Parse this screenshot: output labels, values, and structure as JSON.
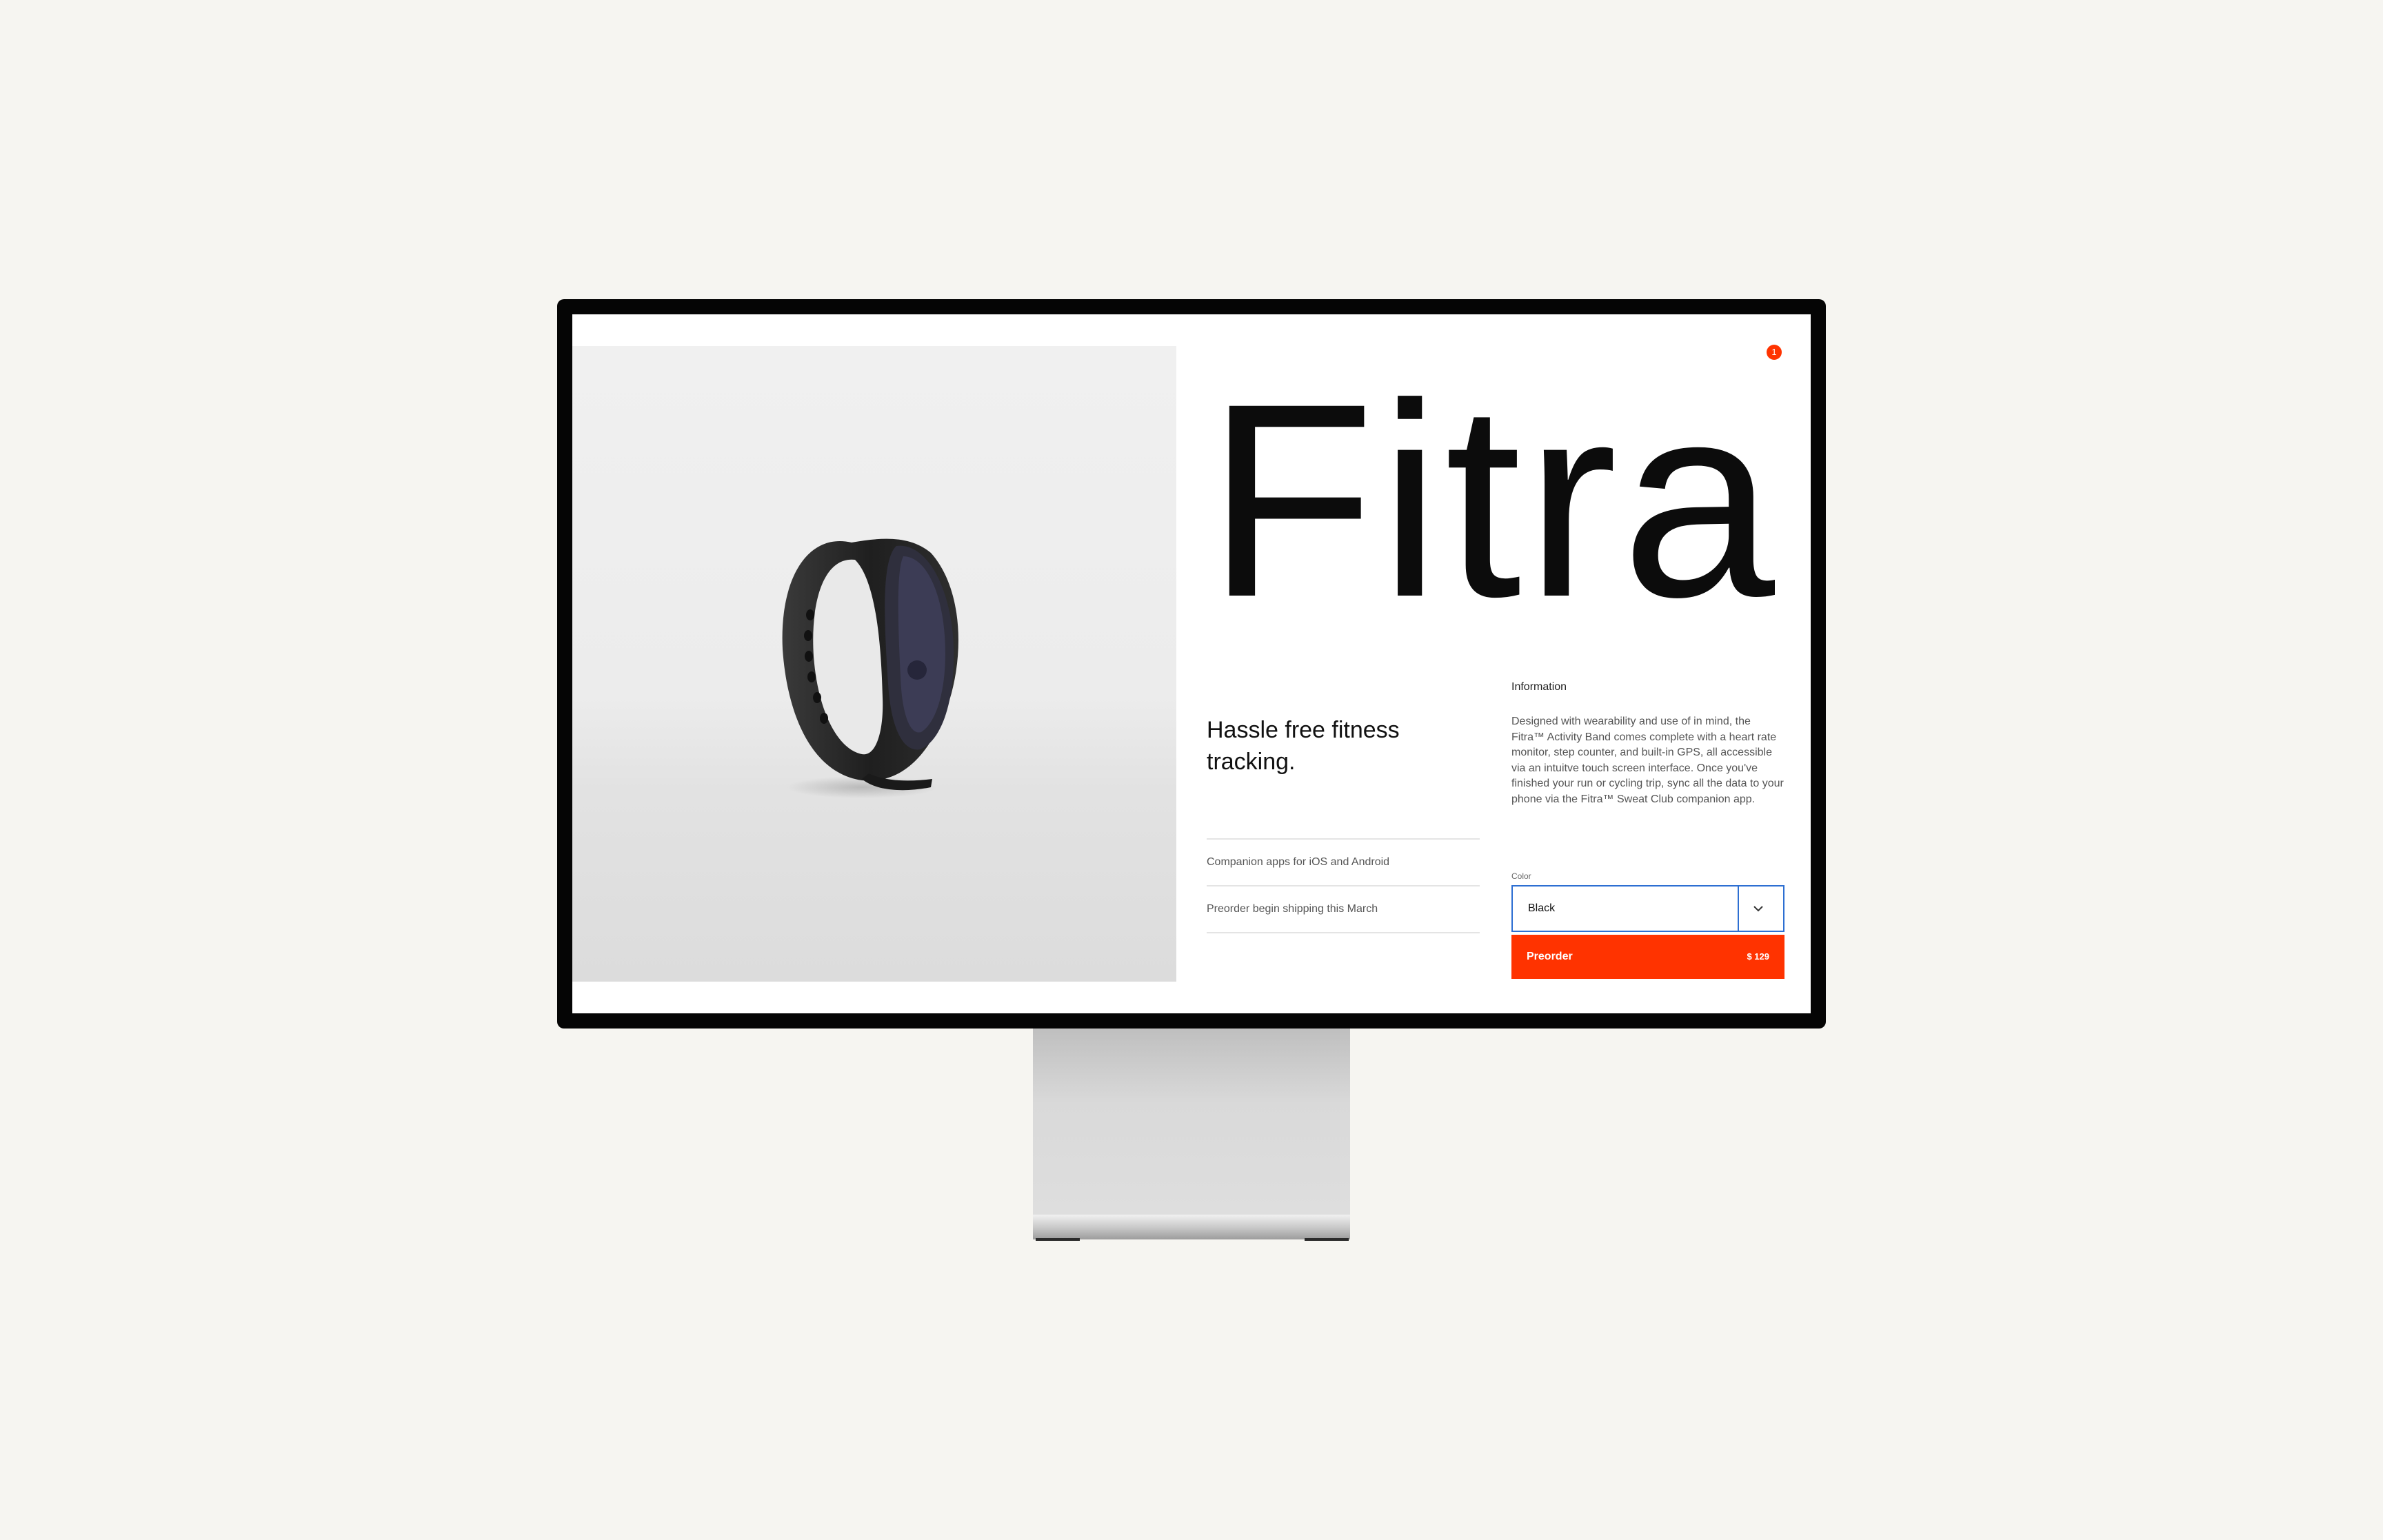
{
  "product": {
    "name": "Fitra",
    "tagline": "Hassle free fitness tracking.",
    "cart_count": "1",
    "features": [
      "Companion apps for iOS and Android",
      "Preorder begin shipping this March"
    ]
  },
  "info": {
    "title": "Information",
    "body": "Designed with wearability and use of in mind, the Fitra™ Activity Band comes complete with a heart rate monitor, step counter, and built-in GPS, all accessible via an intuitve touch screen interface. Once you've finished your run or cycling trip, sync all the data to your phone via the Fitra™ Sweat Club companion app."
  },
  "color_select": {
    "label": "Color",
    "value": "Black"
  },
  "preorder": {
    "label": "Preorder",
    "price": "$ 129"
  },
  "colors": {
    "accent": "#ff3300",
    "focus_border": "#2d6fd2",
    "backdrop": "#f6f5f1"
  },
  "icons": {
    "select_chevron": "chevron-down-icon",
    "cart_badge": "cart-badge"
  }
}
